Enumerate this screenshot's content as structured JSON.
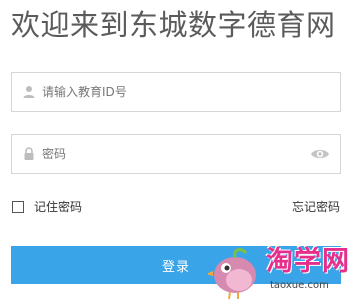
{
  "header": {
    "title": "欢迎来到东城数字德育网"
  },
  "form": {
    "account_placeholder": "请输入教育ID号",
    "password_placeholder": "密码",
    "remember_label": "记住密码",
    "forgot_label": "忘记密码",
    "login_label": "登录"
  },
  "watermark": {
    "brand": "淘学网",
    "url": "taoxue.com"
  },
  "icons": {
    "account": "user-icon",
    "password": "lock-icon",
    "reveal": "eye-icon"
  },
  "colors": {
    "primary_button": "#3aa4e8",
    "watermark_brand": "#e62f8d"
  }
}
